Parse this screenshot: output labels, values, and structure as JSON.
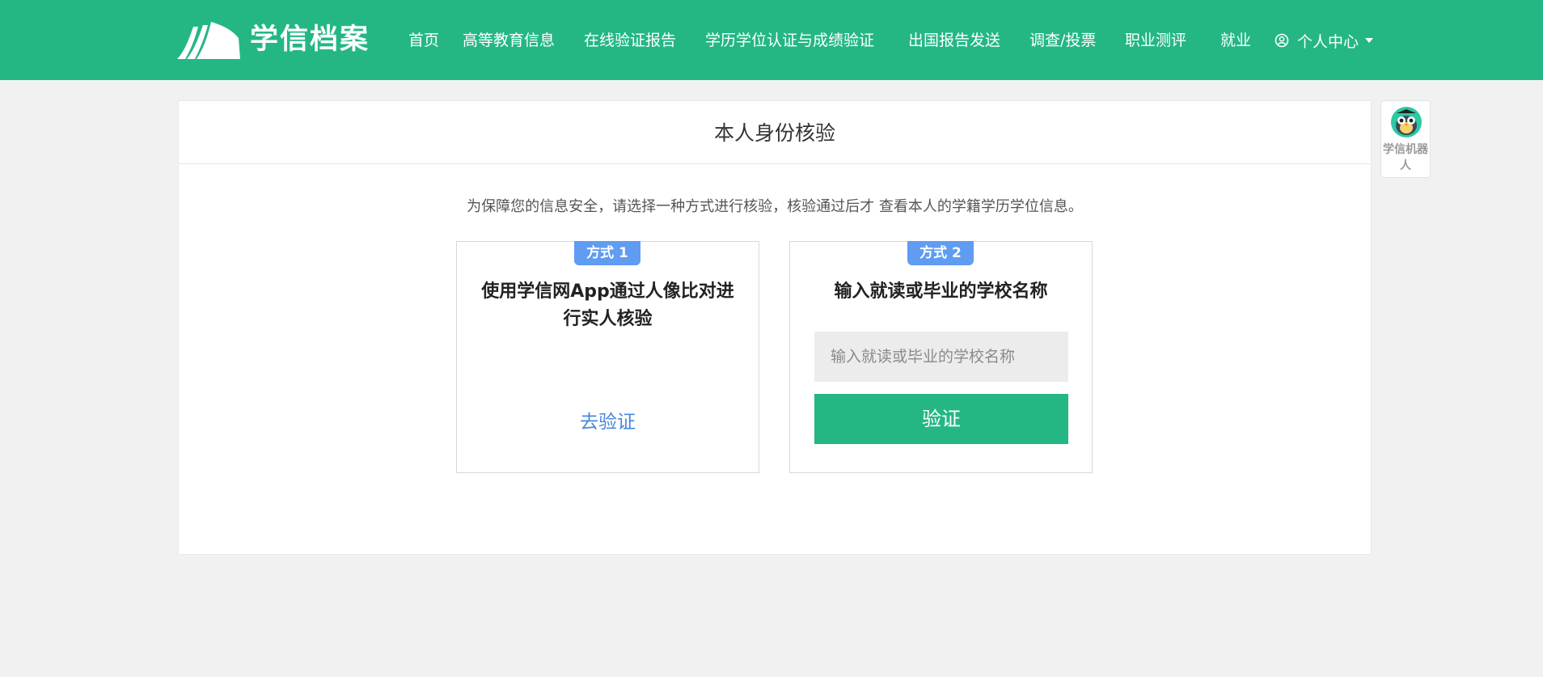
{
  "header": {
    "logo_text": "学信档案",
    "nav": [
      "首页",
      "高等教育信息",
      "在线验证报告",
      "学历学位认证与成绩验证",
      "出国报告发送",
      "调查/投票",
      "职业测评",
      "就业"
    ],
    "user_menu": "个人中心"
  },
  "main": {
    "title": "本人身份核验",
    "notice": "为保障您的信息安全，请选择一种方式进行核验，核验通过后才 查看本人的学籍学历学位信息。",
    "method1": {
      "badge": "方式 1",
      "title": "使用学信网App通过人像比对进行实人核验",
      "link": "去验证"
    },
    "method2": {
      "badge": "方式 2",
      "title": "输入就读或毕业的学校名称",
      "placeholder": "输入就读或毕业的学校名称",
      "button": "验证"
    }
  },
  "robot": {
    "label": "学信机器人"
  },
  "colors": {
    "brand": "#24b784",
    "badge": "#5f9cf2",
    "link": "#4a86d8"
  }
}
